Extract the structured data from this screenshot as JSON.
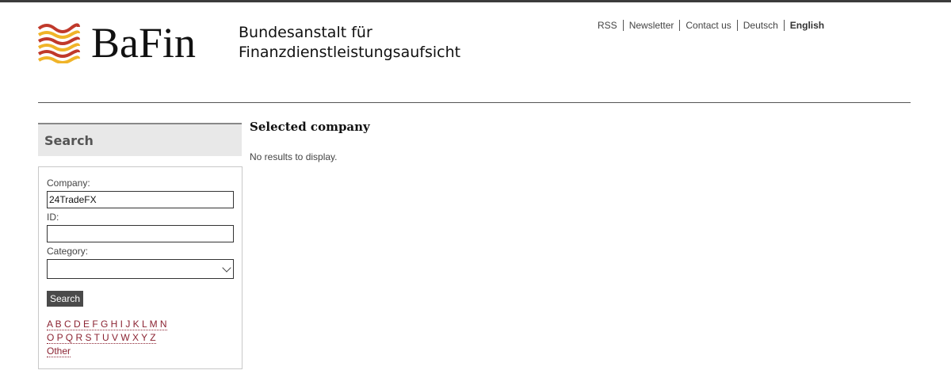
{
  "header": {
    "logo_text": "BaFin",
    "agency_line1": "Bundesanstalt für",
    "agency_line2": "Finanzdienstleistungsaufsicht",
    "nav": [
      {
        "label": "RSS"
      },
      {
        "label": "Newsletter"
      },
      {
        "label": "Contact us"
      },
      {
        "label": "Deutsch"
      },
      {
        "label": "English",
        "active": true
      }
    ]
  },
  "sidebar": {
    "title": "Search",
    "company_label": "Company:",
    "company_value": "24TradeFX",
    "id_label": "ID:",
    "id_value": "",
    "category_label": "Category:",
    "category_value": "",
    "search_button": "Search",
    "alphabet_row1": "A B C D E F G H I J K L M N",
    "alphabet_row2": "O P Q R S T U V W X Y Z",
    "other_link": "Other"
  },
  "main": {
    "heading": "Selected company",
    "message": "No results to display."
  },
  "colors": {
    "link": "#8b2332",
    "logo_red": "#c0392b",
    "logo_yellow": "#f0b429"
  }
}
